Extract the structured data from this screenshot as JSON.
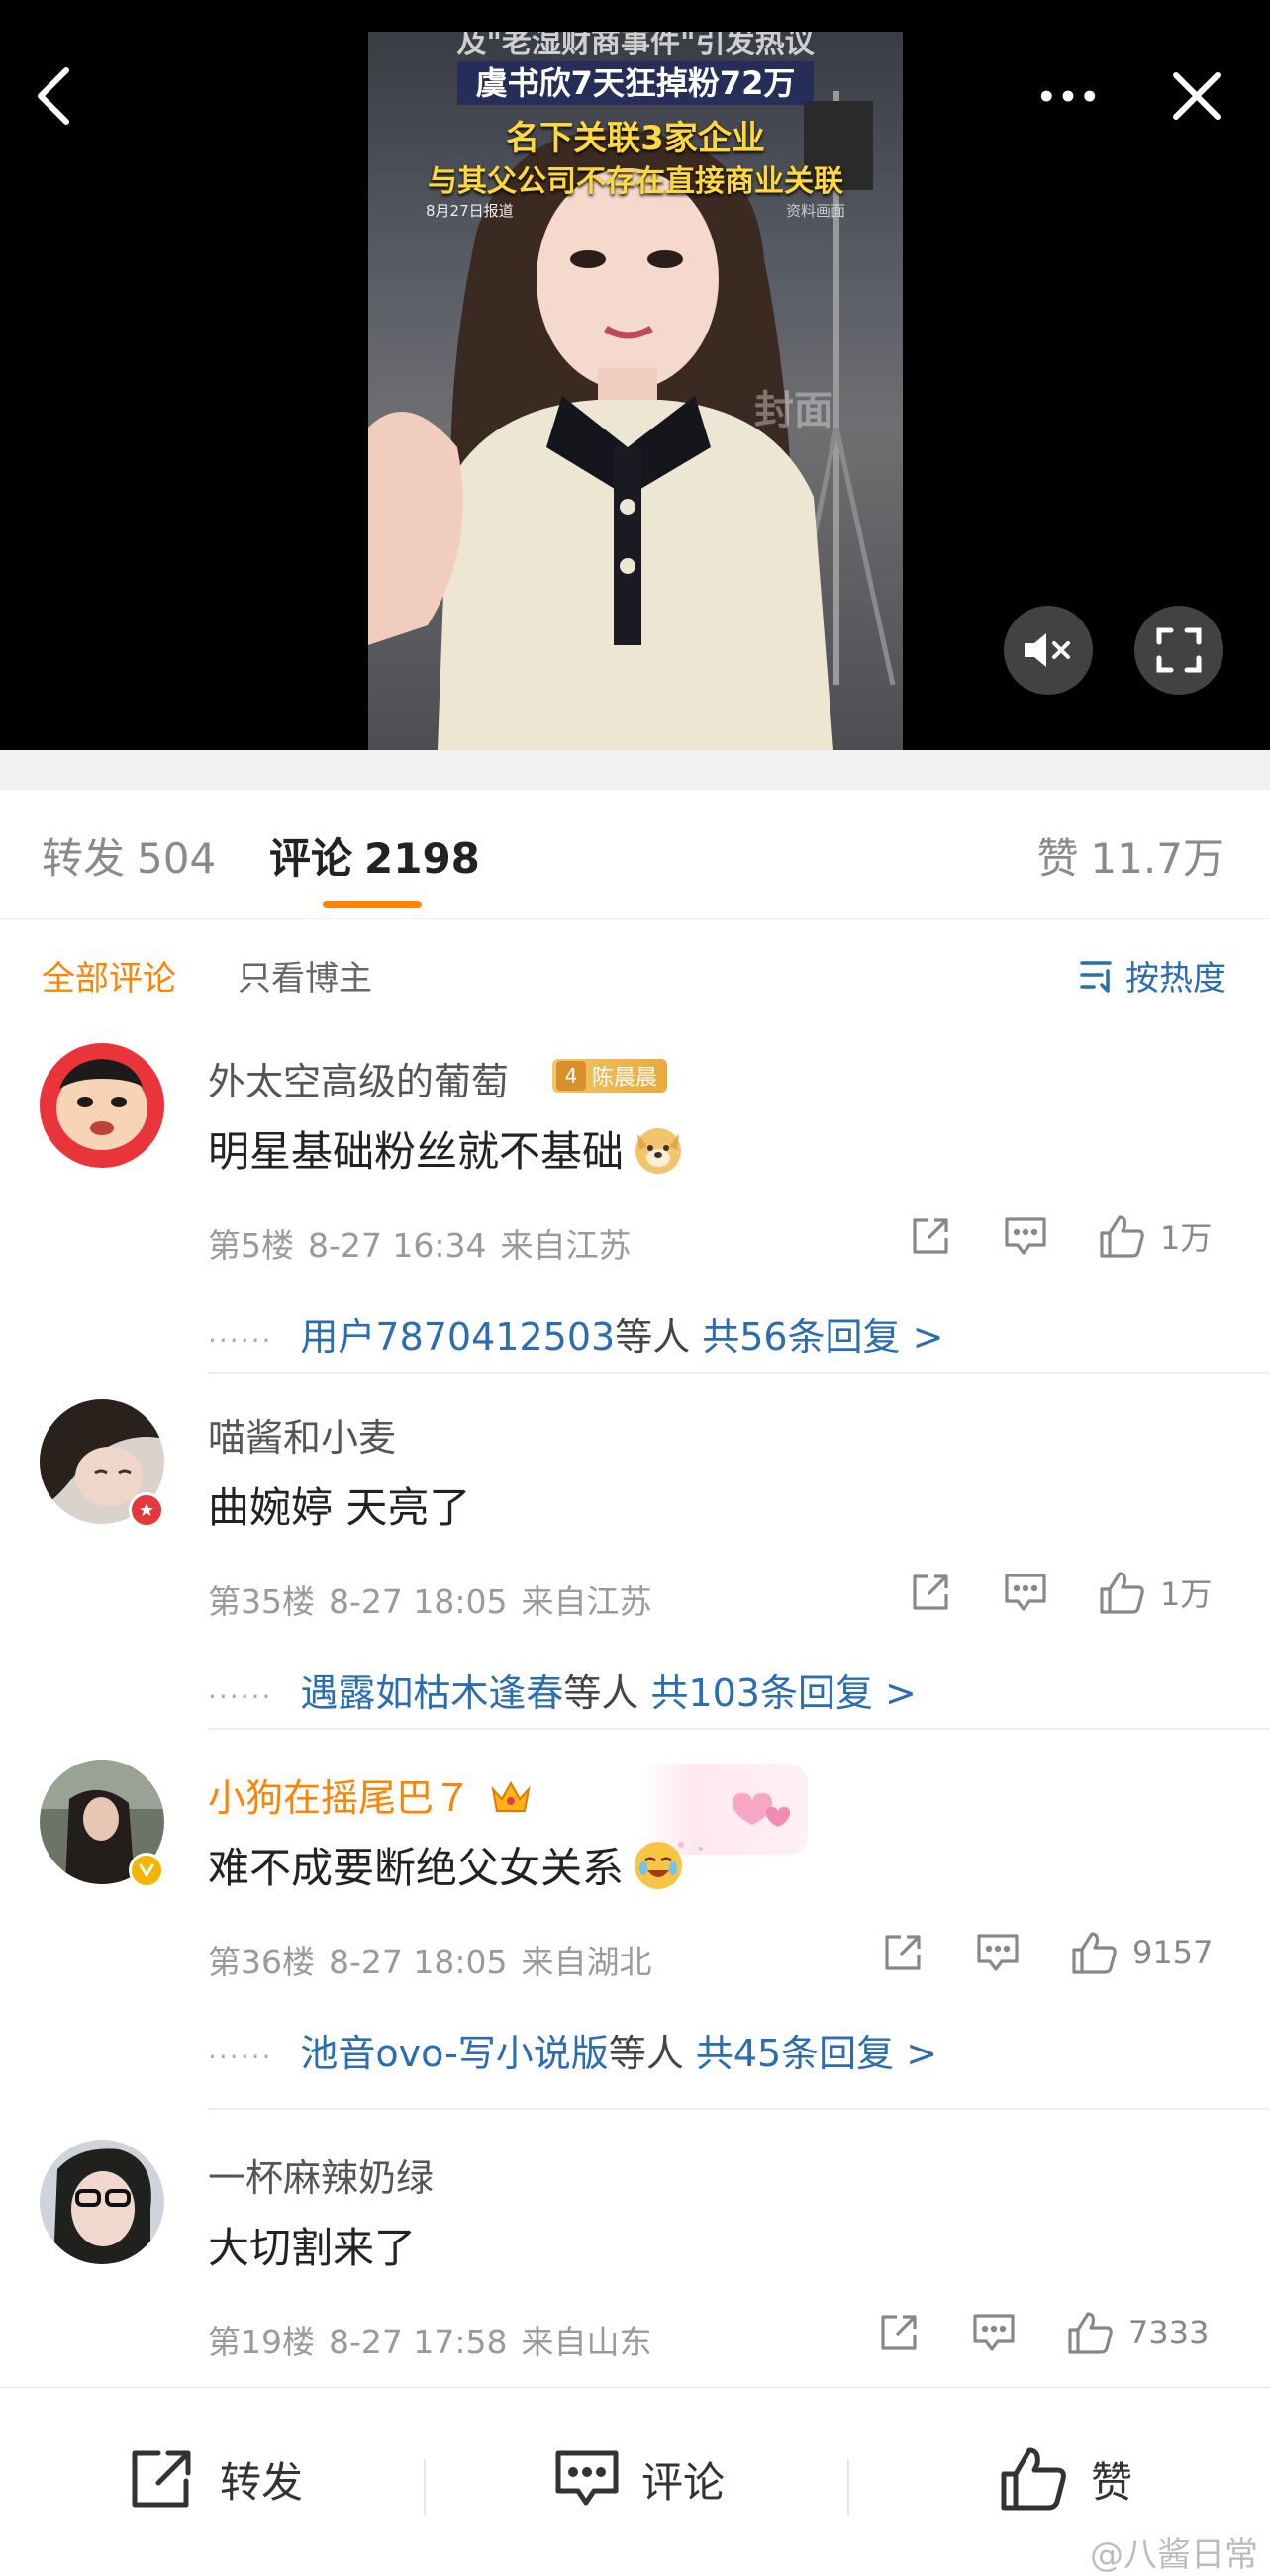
{
  "video": {
    "headline_top": "及\"老湿财商事件\"引发热议",
    "headline_1": "虞书欣7天狂掉粉72万",
    "headline_2": "名下关联3家企业",
    "headline_3": "与其父公司不存在直接商业关联",
    "date_note": "8月27日报道",
    "source_note": "资料画面",
    "watermark": "封面"
  },
  "stats": {
    "repost_label": "转发",
    "repost_count": "504",
    "comment_label": "评论",
    "comment_count": "2198",
    "like_label": "赞",
    "like_count": "11.7万"
  },
  "filters": {
    "all": "全部评论",
    "owner_only": "只看博主",
    "sort": "按热度"
  },
  "comments": [
    {
      "user": "外太空高级的葡萄",
      "medal_level": "4",
      "medal_name": "陈晨晨",
      "text": "明星基础粉丝就不基础",
      "floor": "第5楼",
      "time": "8-27 16:34",
      "location": "来自江苏",
      "likes": "1万",
      "reply_user": "用户7870412503",
      "reply_mid": "等人",
      "reply_count": "共56条回复 >"
    },
    {
      "user": "喵酱和小麦",
      "text": "曲婉婷 天亮了",
      "floor": "第35楼",
      "time": "8-27 18:05",
      "location": "来自江苏",
      "likes": "1万",
      "reply_user": "遇露如枯木逢春",
      "reply_mid": "等人",
      "reply_count": "共103条回复 >"
    },
    {
      "user": "小狗在摇尾巴７",
      "text": "难不成要断绝父女关系",
      "floor": "第36楼",
      "time": "8-27 18:05",
      "location": "来自湖北",
      "likes": "9157",
      "reply_user": "池音ovo-写小说版",
      "reply_mid": "等人",
      "reply_count": "共45条回复 >"
    },
    {
      "user": "一杯麻辣奶绿",
      "text": "大切割来了",
      "floor": "第19楼",
      "time": "8-27 17:58",
      "location": "来自山东",
      "likes": "7333"
    }
  ],
  "bottom": {
    "repost": "转发",
    "comment": "评论",
    "like": "赞"
  },
  "watermark": "@八酱日常",
  "colors": {
    "accent_orange": "#ff8200",
    "link_blue": "#2a6db3",
    "vip_name": "#ff8200"
  },
  "icons": [
    "back-icon",
    "more-icon",
    "close-icon",
    "mute-icon",
    "fullscreen-icon",
    "sort-icon",
    "share-icon",
    "comment-icon",
    "like-icon",
    "verified-badge-icon",
    "crown-icon",
    "dog-emoji-icon",
    "laugh-cry-emoji-icon"
  ]
}
